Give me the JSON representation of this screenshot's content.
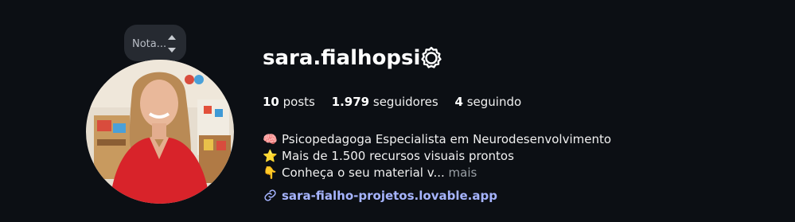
{
  "note": {
    "text": "Nota..."
  },
  "profile": {
    "username": "sara.fialhopsi",
    "settings_icon": "gear-icon"
  },
  "stats": {
    "posts_count": "10",
    "posts_label": "posts",
    "followers_count": "1.979",
    "followers_label": "seguidores",
    "following_count": "4",
    "following_label": "seguindo"
  },
  "bio": {
    "lines": [
      {
        "emoji": "🧠",
        "text": "Psicopedagoga Especialista em Neurodesenvolvimento"
      },
      {
        "emoji": "⭐",
        "text": "Mais de 1.500 recursos visuais prontos"
      },
      {
        "emoji": "👇",
        "text": "Conheça o seu material v..."
      }
    ],
    "more_label": "mais"
  },
  "link": {
    "text": "sara-fialho-projetos.lovable.app",
    "icon": "link-icon"
  },
  "colors": {
    "background": "#0c0f14",
    "link": "#a6b4ff",
    "note_bubble": "#262a31"
  }
}
